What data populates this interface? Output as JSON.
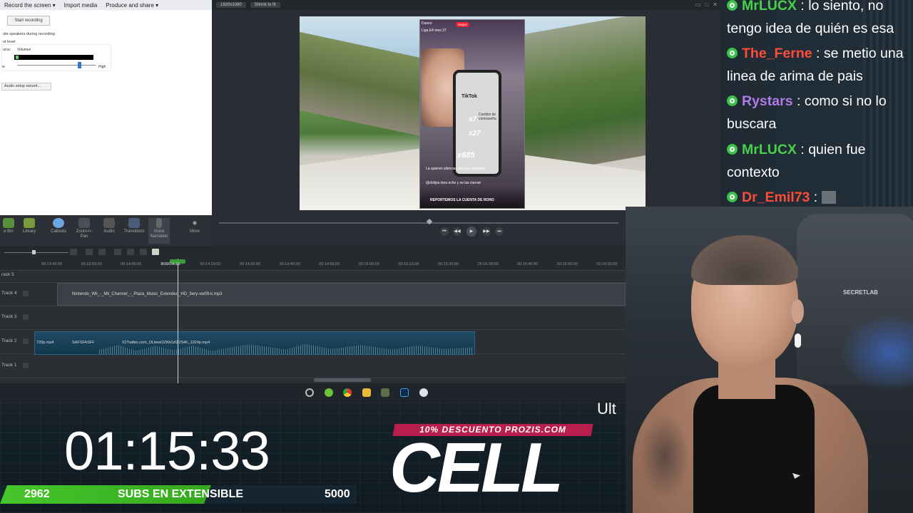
{
  "editor": {
    "menu": [
      "Record the screen ▾",
      "Import media",
      "Produce and share ▾"
    ],
    "recording": {
      "start_button": "Start recording",
      "mute_label": "ute speakers during recording",
      "input_level_label": "ut level",
      "source_label": "urce:",
      "source_value": "Volumen",
      "low_label": "w",
      "high_label": "High",
      "audio_setup_button": "Audio setup wizard...",
      "volume_level": 0.82
    },
    "preview": {
      "dimensions_pill": "1920x1080",
      "zoom_pill": "Shrink to fit"
    },
    "tools": [
      "e Bin",
      "Library",
      "Callouts",
      "Zoom-n-Pan",
      "Audio",
      "Transitions",
      "Voice Narration",
      "More"
    ],
    "ruler_ticks": [
      "00:13:40;00",
      "00:13:50;00",
      "00:14:00;00",
      "00:14:10;00",
      "00:14:20;00",
      "00:14:30;00",
      "00:14:40;00",
      "00:14:50;00",
      "00:15:00;00",
      "00:15:10;00",
      "00:15:20;00",
      "00:15:30;00",
      "00:15:40;00",
      "00:15:50;00",
      "00:16:00;00"
    ],
    "playhead_time": "0:00:14:15",
    "tracks": [
      "rack 5",
      "Track 4",
      "Track 3",
      "Track 2",
      "Track 1"
    ],
    "audio_clip": "Nintendo_Wii_-_Mii_Channel_-_Plaza_Music_Extended_HD_3ery-xw09-k.mp3",
    "video_clips": [
      "720p.mp4",
      "SAFSFASFF",
      "X2Twitter.com_OLlwwOZKb1zfZ2S4K_1024p.mp4"
    ]
  },
  "tiktok": {
    "account": "Dunes",
    "follow": "Seguir",
    "league": "Liga E4 mes 37",
    "logo": "TikTok",
    "card_text": "Cambio de contraseña",
    "multiplier_a": "x7",
    "multiplier_b": "x27",
    "multiplier_c": "x685",
    "comment_1": "La quieren silenciar hay que ayudarla",
    "comment_2": "@dollyia lona echo y se las cierran",
    "banner": "REPORTEMOS LA CUENTA DE RORO"
  },
  "overlay": {
    "timer": "01:15:33",
    "subs_current": "2962",
    "subs_label": "SUBS EN EXTENSIBLE",
    "subs_goal": "5000",
    "subs_progress": 0.5924,
    "promo": "10% DESCUENTO PROZIS.COM",
    "brand": "CELL",
    "ticker_fragment": "Ult"
  },
  "chat": {
    "messages": [
      {
        "user": "MrLUCX",
        "color": "#49d14a",
        "text": "lo siento, no tengo idea de quién es esa"
      },
      {
        "user": "The_Ferne",
        "color": "#ff4b3a",
        "text": "se metio una linea de arima de pais"
      },
      {
        "user": "Rystars",
        "color": "#b07be6",
        "text": "como si no lo buscara"
      },
      {
        "user": "MrLUCX",
        "color": "#49d14a",
        "text": "quien fue contexto"
      },
      {
        "user": "Dr_Emil73",
        "color": "#ff4b3a",
        "text": ""
      }
    ]
  },
  "webcam": {
    "chair_logo": "SECRETLAB"
  }
}
